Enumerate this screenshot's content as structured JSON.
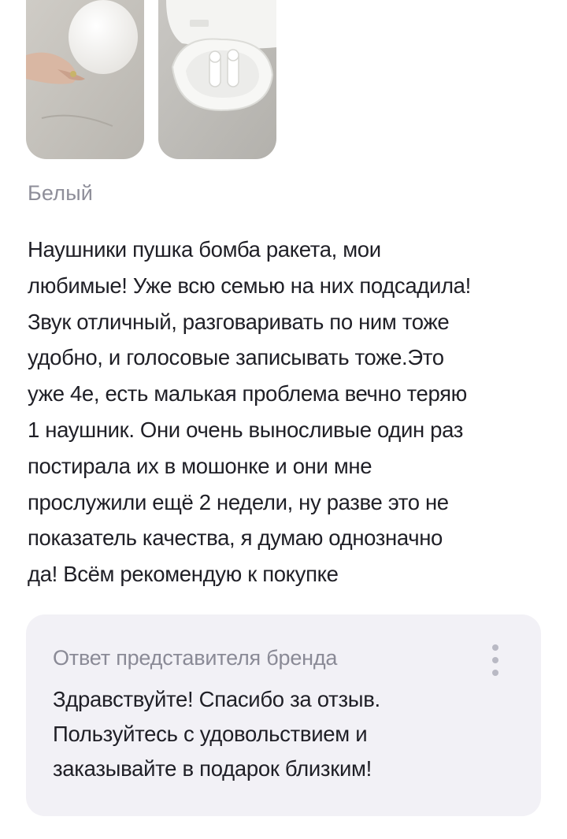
{
  "photos": [
    {
      "icon": "egg-in-hand-photo"
    },
    {
      "icon": "earbuds-case-photo"
    }
  ],
  "review": {
    "variant": "Белый",
    "text": "Наушники пушка бомба ракета, мои\nлюбимые! Уже всю семью на них подсадила!\nЗвук отличный, разговаривать по ним тоже\nудобно, и голосовые записывать тоже.Это\nуже 4е, есть малькая проблема вечно теряю\n1 наушник. Они очень выносливые один раз\nпостирала их в  мошонке и они мне\nпрослужили ещё 2 недели, ну разве это не\nпоказатель качества, я думаю однозначно\nда! Всём рекомендую к покупке"
  },
  "reply": {
    "title": "Ответ представителя бренда",
    "text": "Здравствуйте! Спасибо за отзыв.\nПользуйтесь с удовольствием и\nзаказывайте в подарок близким!",
    "menu_icon": "more-vertical-icon"
  },
  "colors": {
    "muted_text": "#8e8e99",
    "reply_bg": "#f2f1f6",
    "text": "#1f1f26"
  }
}
